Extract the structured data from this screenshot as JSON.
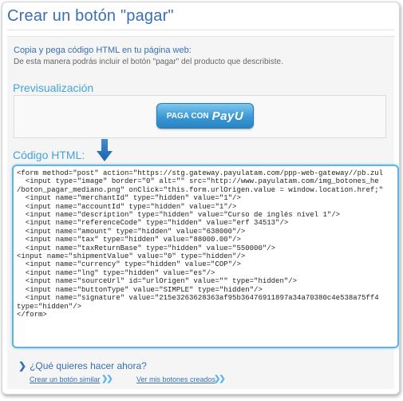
{
  "header": {
    "title": "Crear un botón \"pagar\""
  },
  "intro": {
    "heading": "Copia y pega código HTML en tu página web:",
    "subtext": "De esta manera podrás incluir el botón \"pagar\" del producto que describiste."
  },
  "preview": {
    "title": "Previsualización",
    "button_label": "PAGA CON",
    "button_brand": "PayU",
    "button_brand_sub": "Latam"
  },
  "code": {
    "title": "Código HTML:",
    "lines": [
      "<form method=\"post\" action=\"https://stg.gateway.payulatam.com/ppp-web-gateway//pb.zul",
      "  <input type=\"image\" border=\"0\" alt=\"\" src=\"http://www.payulatam.com/img_botones_he",
      "/boton_pagar_mediano.png\" onClick=\"this.form.urlOrigen.value = window.location.href;\"",
      "  <input name=\"merchantId\" type=\"hidden\" value=\"1\"/>",
      "  <input name=\"accountId\" type=\"hidden\" value=\"1\"/>",
      "  <input name=\"description\" type=\"hidden\" value=\"Curso de inglés nivel 1\"/>",
      "  <input name=\"referenceCode\" type=\"hidden\" value=\"erf 34513\"/>",
      "  <input name=\"amount\" type=\"hidden\" value=\"638000\"/>",
      "  <input name=\"tax\" type=\"hidden\" value=\"88000.00\"/>",
      "  <input name=\"taxReturnBase\" type=\"hidden\" value=\"550000\"/>",
      "<input name=\"shipmentValue\" value=\"0\" type=\"hidden\"/>",
      "  <input name=\"currency\" type=\"hidden\" value=\"COP\"/>",
      "  <input name=\"lng\" type=\"hidden\" value=\"es\"/>",
      "  <input name=\"sourceUrl\" id=\"urlOrigen\" value=\"\" type=\"hidden\"/>",
      "  <input name=\"buttonType\" value=\"SIMPLE\" type=\"hidden\"/>",
      "  <input name=\"signature\" value=\"215e3263628363af95b36476911897a34a70380c4e538a75ff4",
      "type=\"hidden\"/>",
      "</form>"
    ]
  },
  "next": {
    "question": "¿Qué quieres hacer ahora?",
    "link_similar": "Crear un botón similar",
    "link_mine": "Ver mis botones creados"
  },
  "colors": {
    "title_blue": "#3a6fb2",
    "section_blue": "#45a3d8",
    "code_border": "#5db6e3",
    "button_blue": "#3a98d4"
  },
  "icons": {
    "arrow": "arrow-down-icon",
    "question_chevron": "chevron-right-icon",
    "link_chevron": "double-chevron-right-icon"
  }
}
